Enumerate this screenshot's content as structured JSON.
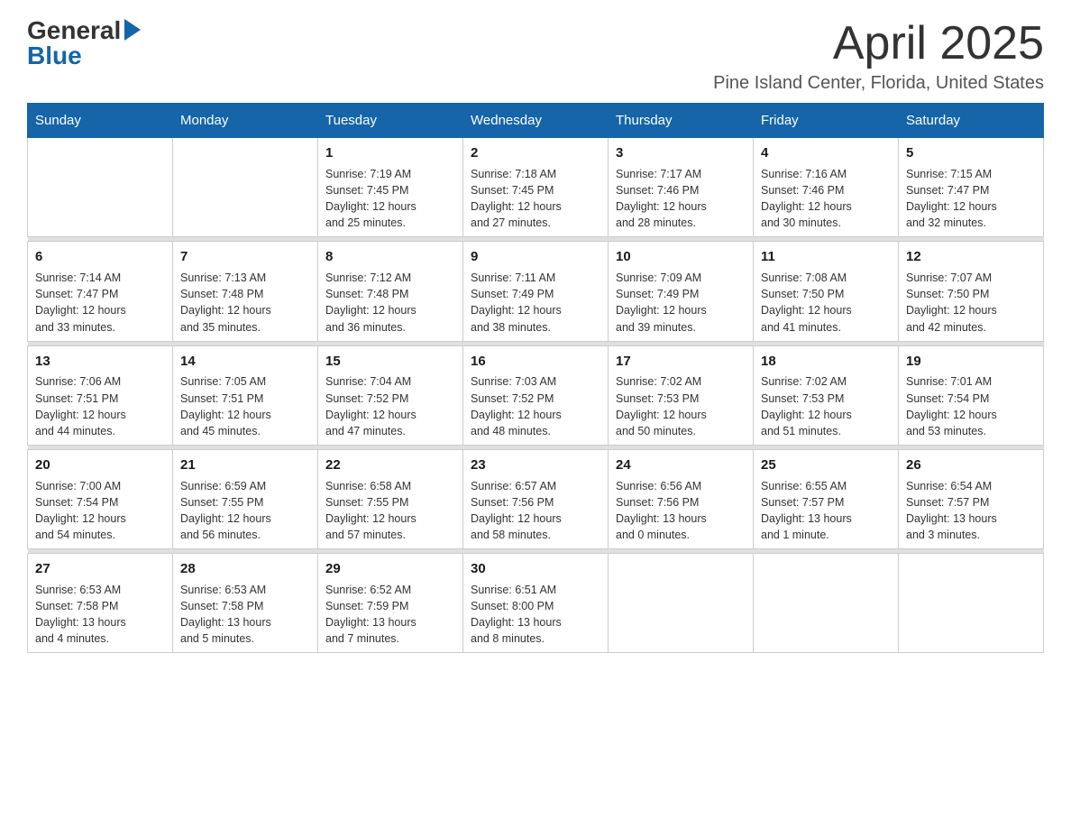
{
  "header": {
    "logo": {
      "general": "General",
      "blue": "Blue"
    },
    "title": "April 2025",
    "location": "Pine Island Center, Florida, United States"
  },
  "calendar": {
    "days_of_week": [
      "Sunday",
      "Monday",
      "Tuesday",
      "Wednesday",
      "Thursday",
      "Friday",
      "Saturday"
    ],
    "weeks": [
      [
        {
          "day": "",
          "info": ""
        },
        {
          "day": "",
          "info": ""
        },
        {
          "day": "1",
          "info": "Sunrise: 7:19 AM\nSunset: 7:45 PM\nDaylight: 12 hours\nand 25 minutes."
        },
        {
          "day": "2",
          "info": "Sunrise: 7:18 AM\nSunset: 7:45 PM\nDaylight: 12 hours\nand 27 minutes."
        },
        {
          "day": "3",
          "info": "Sunrise: 7:17 AM\nSunset: 7:46 PM\nDaylight: 12 hours\nand 28 minutes."
        },
        {
          "day": "4",
          "info": "Sunrise: 7:16 AM\nSunset: 7:46 PM\nDaylight: 12 hours\nand 30 minutes."
        },
        {
          "day": "5",
          "info": "Sunrise: 7:15 AM\nSunset: 7:47 PM\nDaylight: 12 hours\nand 32 minutes."
        }
      ],
      [
        {
          "day": "6",
          "info": "Sunrise: 7:14 AM\nSunset: 7:47 PM\nDaylight: 12 hours\nand 33 minutes."
        },
        {
          "day": "7",
          "info": "Sunrise: 7:13 AM\nSunset: 7:48 PM\nDaylight: 12 hours\nand 35 minutes."
        },
        {
          "day": "8",
          "info": "Sunrise: 7:12 AM\nSunset: 7:48 PM\nDaylight: 12 hours\nand 36 minutes."
        },
        {
          "day": "9",
          "info": "Sunrise: 7:11 AM\nSunset: 7:49 PM\nDaylight: 12 hours\nand 38 minutes."
        },
        {
          "day": "10",
          "info": "Sunrise: 7:09 AM\nSunset: 7:49 PM\nDaylight: 12 hours\nand 39 minutes."
        },
        {
          "day": "11",
          "info": "Sunrise: 7:08 AM\nSunset: 7:50 PM\nDaylight: 12 hours\nand 41 minutes."
        },
        {
          "day": "12",
          "info": "Sunrise: 7:07 AM\nSunset: 7:50 PM\nDaylight: 12 hours\nand 42 minutes."
        }
      ],
      [
        {
          "day": "13",
          "info": "Sunrise: 7:06 AM\nSunset: 7:51 PM\nDaylight: 12 hours\nand 44 minutes."
        },
        {
          "day": "14",
          "info": "Sunrise: 7:05 AM\nSunset: 7:51 PM\nDaylight: 12 hours\nand 45 minutes."
        },
        {
          "day": "15",
          "info": "Sunrise: 7:04 AM\nSunset: 7:52 PM\nDaylight: 12 hours\nand 47 minutes."
        },
        {
          "day": "16",
          "info": "Sunrise: 7:03 AM\nSunset: 7:52 PM\nDaylight: 12 hours\nand 48 minutes."
        },
        {
          "day": "17",
          "info": "Sunrise: 7:02 AM\nSunset: 7:53 PM\nDaylight: 12 hours\nand 50 minutes."
        },
        {
          "day": "18",
          "info": "Sunrise: 7:02 AM\nSunset: 7:53 PM\nDaylight: 12 hours\nand 51 minutes."
        },
        {
          "day": "19",
          "info": "Sunrise: 7:01 AM\nSunset: 7:54 PM\nDaylight: 12 hours\nand 53 minutes."
        }
      ],
      [
        {
          "day": "20",
          "info": "Sunrise: 7:00 AM\nSunset: 7:54 PM\nDaylight: 12 hours\nand 54 minutes."
        },
        {
          "day": "21",
          "info": "Sunrise: 6:59 AM\nSunset: 7:55 PM\nDaylight: 12 hours\nand 56 minutes."
        },
        {
          "day": "22",
          "info": "Sunrise: 6:58 AM\nSunset: 7:55 PM\nDaylight: 12 hours\nand 57 minutes."
        },
        {
          "day": "23",
          "info": "Sunrise: 6:57 AM\nSunset: 7:56 PM\nDaylight: 12 hours\nand 58 minutes."
        },
        {
          "day": "24",
          "info": "Sunrise: 6:56 AM\nSunset: 7:56 PM\nDaylight: 13 hours\nand 0 minutes."
        },
        {
          "day": "25",
          "info": "Sunrise: 6:55 AM\nSunset: 7:57 PM\nDaylight: 13 hours\nand 1 minute."
        },
        {
          "day": "26",
          "info": "Sunrise: 6:54 AM\nSunset: 7:57 PM\nDaylight: 13 hours\nand 3 minutes."
        }
      ],
      [
        {
          "day": "27",
          "info": "Sunrise: 6:53 AM\nSunset: 7:58 PM\nDaylight: 13 hours\nand 4 minutes."
        },
        {
          "day": "28",
          "info": "Sunrise: 6:53 AM\nSunset: 7:58 PM\nDaylight: 13 hours\nand 5 minutes."
        },
        {
          "day": "29",
          "info": "Sunrise: 6:52 AM\nSunset: 7:59 PM\nDaylight: 13 hours\nand 7 minutes."
        },
        {
          "day": "30",
          "info": "Sunrise: 6:51 AM\nSunset: 8:00 PM\nDaylight: 13 hours\nand 8 minutes."
        },
        {
          "day": "",
          "info": ""
        },
        {
          "day": "",
          "info": ""
        },
        {
          "day": "",
          "info": ""
        }
      ]
    ]
  }
}
